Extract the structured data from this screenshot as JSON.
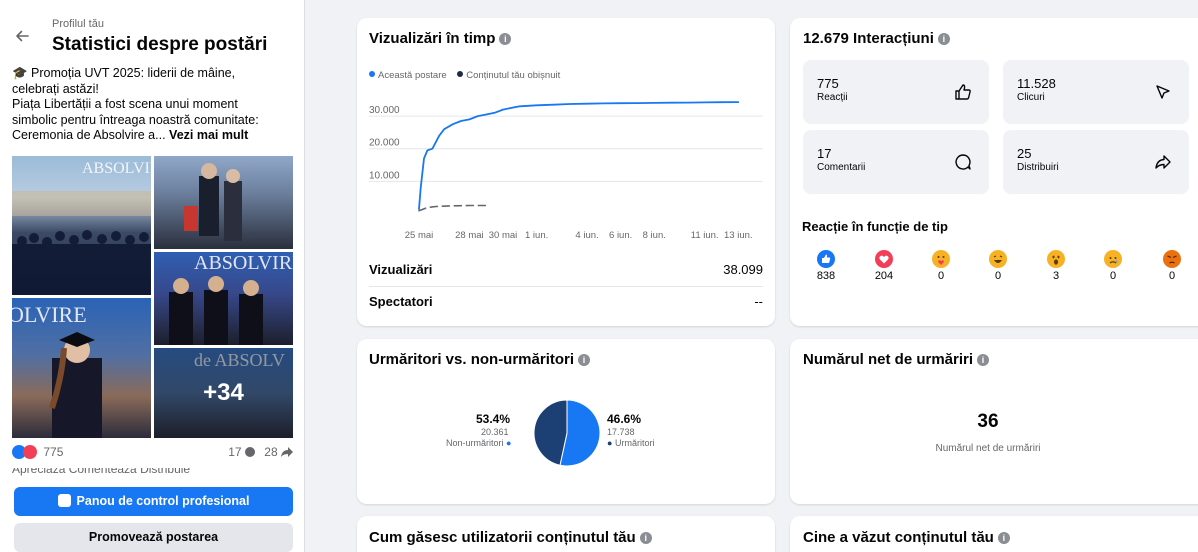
{
  "sidebar": {
    "eyebrow": "Profilul tău",
    "title": "Statistici despre postări",
    "caption": {
      "line1": "🎓 Promoția UVT 2025: liderii de mâine,",
      "line2": "celebrați astăzi!",
      "line3": "Piața Libertății a fost scena unui moment",
      "line4": "simbolic pentru întreaga noastră comunitate:",
      "line5": "Ceremonia de Absolvire a...",
      "more": "Vezi mai mult"
    },
    "photos": {
      "overlay_count": "+34",
      "text_absolvire": "ABSOLVIRE",
      "text_olvire": "OLVIRE",
      "text_de_absolv": "de ABSOLV"
    },
    "reactions_count": "775",
    "comments_count": "17",
    "shares_count": "28",
    "cut_actions": "Apreciază    Comentează    Distribuie",
    "primary_button": "Panou de control profesional",
    "secondary_button": "Promovează postarea"
  },
  "views_card": {
    "title": "Vizualizări în timp",
    "legend": [
      {
        "label": "Această postare",
        "color": "#1877f2"
      },
      {
        "label": "Conținutul tău obișnuit",
        "color": "#1c2b4a"
      }
    ],
    "rows": [
      {
        "label": "Vizualizări",
        "value": "38.099"
      },
      {
        "label": "Spectatori",
        "value": "--"
      }
    ]
  },
  "chart_data": {
    "type": "line",
    "title": "Vizualizări în timp",
    "y_tick_labels": [
      "10.000",
      "20.000",
      "30.000"
    ],
    "y_ticks": [
      10000,
      20000,
      30000
    ],
    "ylim": [
      0,
      38000
    ],
    "x_tick_labels": [
      "25 mai",
      "28 mai",
      "30 mai",
      "1 iun.",
      "4 iun.",
      "6 iun.",
      "8 iun.",
      "11 iun.",
      "13 iun."
    ],
    "x_tick_days": [
      0,
      3,
      5,
      7,
      10,
      12,
      14,
      17,
      19
    ],
    "xlim": [
      0,
      19.4
    ],
    "grid": true,
    "series": [
      {
        "name": "Această postare",
        "color": "#1877f2",
        "style": "solid",
        "x": [
          0,
          0.1,
          0.3,
          0.5,
          0.8,
          1.0,
          1.2,
          1.5,
          2.0,
          2.5,
          3.0,
          3.5,
          4.0,
          4.5,
          5.0,
          5.5,
          6.0,
          7.0,
          8.0,
          9.0,
          10.0,
          11.0,
          12.0,
          13.0,
          14.0,
          15.0,
          16.0,
          17.0,
          18.0,
          19.0
        ],
        "y": [
          1500,
          8000,
          17000,
          19500,
          20000,
          22000,
          24000,
          26000,
          27500,
          28500,
          29000,
          30000,
          30500,
          31000,
          32000,
          32500,
          33000,
          33300,
          33500,
          33700,
          33800,
          33900,
          33950,
          34000,
          34050,
          34100,
          34150,
          34200,
          34250,
          34300
        ]
      },
      {
        "name": "Conținutul tău obișnuit",
        "color": "#65676b",
        "style": "dashed",
        "x": [
          0,
          0.5,
          1.0,
          2.0,
          3.0,
          4.0
        ],
        "y": [
          1000,
          2000,
          2300,
          2500,
          2600,
          2600
        ]
      }
    ]
  },
  "interactions_card": {
    "title": "12.679 Interacțiuni",
    "tiles": [
      {
        "value": "775",
        "label": "Reacții",
        "icon": "thumbs-up-icon"
      },
      {
        "value": "11.528",
        "label": "Clicuri",
        "icon": "cursor-click-icon"
      },
      {
        "value": "17",
        "label": "Comentarii",
        "icon": "comment-icon"
      },
      {
        "value": "25",
        "label": "Distribuiri",
        "icon": "share-icon"
      }
    ],
    "reactions_title": "Reacție în funcție de tip",
    "reactions": [
      {
        "type": "like",
        "count": "838",
        "color": "#1877f2"
      },
      {
        "type": "love",
        "count": "204",
        "color": "#f33e58"
      },
      {
        "type": "care",
        "count": "0",
        "color": "#f7b125"
      },
      {
        "type": "haha",
        "count": "0",
        "color": "#f7b125"
      },
      {
        "type": "wow",
        "count": "3",
        "color": "#f7b125"
      },
      {
        "type": "sad",
        "count": "0",
        "color": "#f7b125"
      },
      {
        "type": "angry",
        "count": "0",
        "color": "#e9710f"
      }
    ]
  },
  "followers_card": {
    "title": "Urmăritori vs. non-urmăritori",
    "left": {
      "percent": "53.4%",
      "count": "20.361",
      "label": "Non-urmăritori",
      "color": "#1877f2"
    },
    "right": {
      "percent": "46.6%",
      "count": "17.738",
      "label": "Urmăritori",
      "color": "#1c3f74"
    }
  },
  "net_follows_card": {
    "title": "Numărul net de urmăriri",
    "value": "36",
    "label": "Numărul net de urmăriri"
  },
  "bottom_cards": {
    "left_title": "Cum găsesc utilizatorii conținutul tău",
    "right_title": "Cine a văzut conținutul tău"
  }
}
